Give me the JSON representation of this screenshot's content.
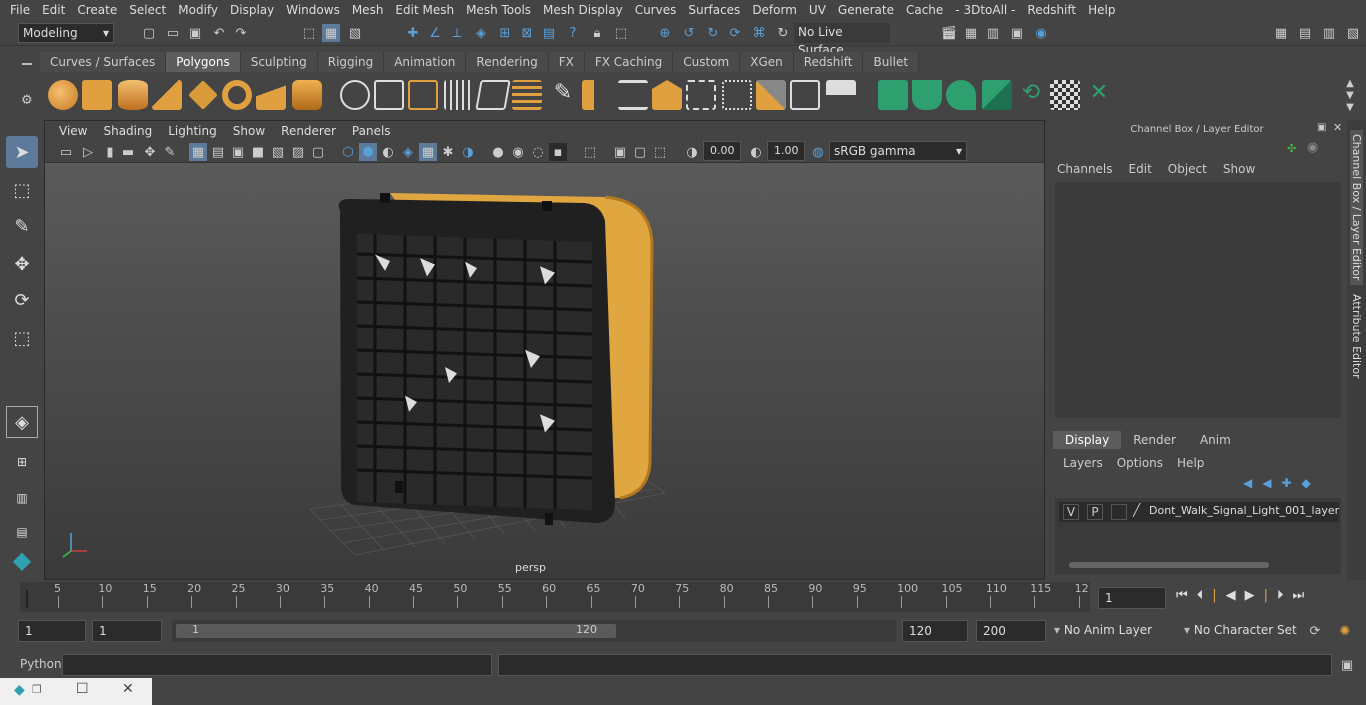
{
  "menubar": {
    "items": [
      "File",
      "Edit",
      "Create",
      "Select",
      "Modify",
      "Display",
      "Windows",
      "Mesh",
      "Edit Mesh",
      "Mesh Tools",
      "Mesh Display",
      "Curves",
      "Surfaces",
      "Deform",
      "UV",
      "Generate",
      "Cache",
      "- 3DtoAll -",
      "Redshift",
      "Help"
    ]
  },
  "status": {
    "workspace": "Modeling",
    "live_surface": "No Live Surface"
  },
  "shelf": {
    "tabs": [
      "Curves / Surfaces",
      "Polygons",
      "Sculpting",
      "Rigging",
      "Animation",
      "Rendering",
      "FX",
      "FX Caching",
      "Custom",
      "XGen",
      "Redshift",
      "Bullet"
    ],
    "active": "Polygons"
  },
  "viewport": {
    "menu": [
      "View",
      "Shading",
      "Lighting",
      "Show",
      "Renderer",
      "Panels"
    ],
    "exposure": "0.00",
    "gamma": "1.00",
    "colorspace": "sRGB gamma",
    "camera": "persp"
  },
  "channelbox": {
    "title": "Channel Box / Layer Editor",
    "menu": [
      "Channels",
      "Edit",
      "Object",
      "Show"
    ],
    "tabs": [
      "Display",
      "Render",
      "Anim"
    ],
    "active_tab": "Display",
    "layer_menu": [
      "Layers",
      "Options",
      "Help"
    ],
    "layer": {
      "v": "V",
      "p": "P",
      "name": "Dont_Walk_Signal_Light_001_layer"
    }
  },
  "side_tabs": {
    "a": "Channel Box / Layer Editor",
    "b": "Attribute Editor"
  },
  "timeline": {
    "ticks": [
      "5",
      "10",
      "15",
      "20",
      "25",
      "30",
      "35",
      "40",
      "45",
      "50",
      "55",
      "60",
      "65",
      "70",
      "75",
      "80",
      "85",
      "90",
      "95",
      "100",
      "105",
      "110",
      "115",
      "12"
    ],
    "start_label": "1",
    "current_frame": "1"
  },
  "range": {
    "start": "1",
    "start2": "1",
    "slider_start": "1",
    "slider_end": "120",
    "end": "120",
    "end2": "200",
    "anim_layer": "No Anim Layer",
    "char_set": "No Character Set"
  },
  "python": {
    "label": "Python"
  },
  "colors": {
    "accent": "#5aa0d8",
    "object": "#e0a640"
  }
}
